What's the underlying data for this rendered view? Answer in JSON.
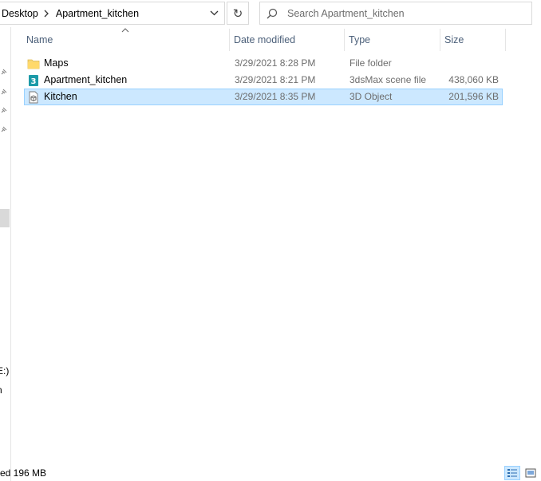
{
  "address_bar": {
    "breadcrumbs": [
      "Desktop",
      "Apartment_kitchen"
    ]
  },
  "search": {
    "placeholder": "Search Apartment_kitchen"
  },
  "columns": {
    "name": "Name",
    "date": "Date modified",
    "type": "Type",
    "size": "Size"
  },
  "files": [
    {
      "name": "Maps",
      "date": "3/29/2021 8:28 PM",
      "type": "File folder",
      "size": "",
      "icon": "folder-icon",
      "selected": false
    },
    {
      "name": "Apartment_kitchen",
      "date": "3/29/2021 8:21 PM",
      "type": "3dsMax scene file",
      "size": "438,060 KB",
      "icon": "3dsmax-file-icon",
      "selected": false
    },
    {
      "name": "Kitchen",
      "date": "3/29/2021 8:35 PM",
      "type": "3D Object",
      "size": "201,596 KB",
      "icon": "3d-object-icon",
      "selected": true
    }
  ],
  "nav_fragments": [
    "E:)",
    "n"
  ],
  "status_bar": {
    "text": "ed  196 MB"
  },
  "colors": {
    "selection_bg": "#cce8ff",
    "selection_border": "#99d1ff",
    "header_text": "#4c607a",
    "secondary_text": "#6d6d6d"
  }
}
